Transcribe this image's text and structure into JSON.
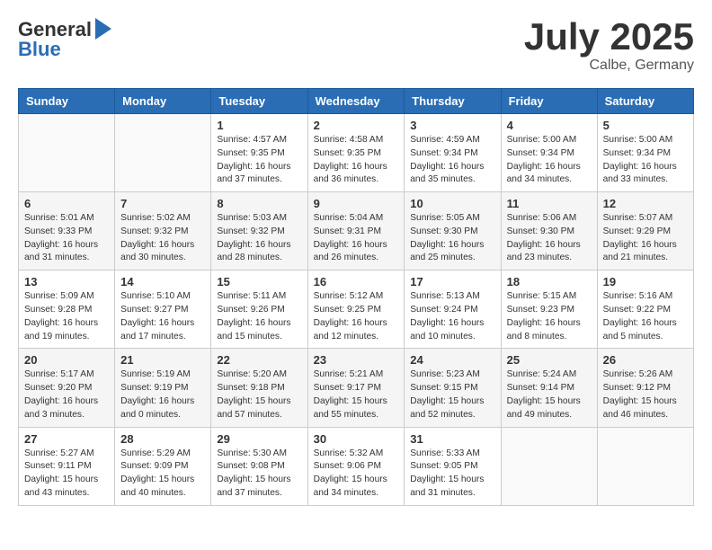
{
  "header": {
    "logo_general": "General",
    "logo_blue": "Blue",
    "title": "July 2025",
    "location": "Calbe, Germany"
  },
  "days_of_week": [
    "Sunday",
    "Monday",
    "Tuesday",
    "Wednesday",
    "Thursday",
    "Friday",
    "Saturday"
  ],
  "weeks": [
    [
      {
        "day": "",
        "info": ""
      },
      {
        "day": "",
        "info": ""
      },
      {
        "day": "1",
        "info": "Sunrise: 4:57 AM\nSunset: 9:35 PM\nDaylight: 16 hours\nand 37 minutes."
      },
      {
        "day": "2",
        "info": "Sunrise: 4:58 AM\nSunset: 9:35 PM\nDaylight: 16 hours\nand 36 minutes."
      },
      {
        "day": "3",
        "info": "Sunrise: 4:59 AM\nSunset: 9:34 PM\nDaylight: 16 hours\nand 35 minutes."
      },
      {
        "day": "4",
        "info": "Sunrise: 5:00 AM\nSunset: 9:34 PM\nDaylight: 16 hours\nand 34 minutes."
      },
      {
        "day": "5",
        "info": "Sunrise: 5:00 AM\nSunset: 9:34 PM\nDaylight: 16 hours\nand 33 minutes."
      }
    ],
    [
      {
        "day": "6",
        "info": "Sunrise: 5:01 AM\nSunset: 9:33 PM\nDaylight: 16 hours\nand 31 minutes."
      },
      {
        "day": "7",
        "info": "Sunrise: 5:02 AM\nSunset: 9:32 PM\nDaylight: 16 hours\nand 30 minutes."
      },
      {
        "day": "8",
        "info": "Sunrise: 5:03 AM\nSunset: 9:32 PM\nDaylight: 16 hours\nand 28 minutes."
      },
      {
        "day": "9",
        "info": "Sunrise: 5:04 AM\nSunset: 9:31 PM\nDaylight: 16 hours\nand 26 minutes."
      },
      {
        "day": "10",
        "info": "Sunrise: 5:05 AM\nSunset: 9:30 PM\nDaylight: 16 hours\nand 25 minutes."
      },
      {
        "day": "11",
        "info": "Sunrise: 5:06 AM\nSunset: 9:30 PM\nDaylight: 16 hours\nand 23 minutes."
      },
      {
        "day": "12",
        "info": "Sunrise: 5:07 AM\nSunset: 9:29 PM\nDaylight: 16 hours\nand 21 minutes."
      }
    ],
    [
      {
        "day": "13",
        "info": "Sunrise: 5:09 AM\nSunset: 9:28 PM\nDaylight: 16 hours\nand 19 minutes."
      },
      {
        "day": "14",
        "info": "Sunrise: 5:10 AM\nSunset: 9:27 PM\nDaylight: 16 hours\nand 17 minutes."
      },
      {
        "day": "15",
        "info": "Sunrise: 5:11 AM\nSunset: 9:26 PM\nDaylight: 16 hours\nand 15 minutes."
      },
      {
        "day": "16",
        "info": "Sunrise: 5:12 AM\nSunset: 9:25 PM\nDaylight: 16 hours\nand 12 minutes."
      },
      {
        "day": "17",
        "info": "Sunrise: 5:13 AM\nSunset: 9:24 PM\nDaylight: 16 hours\nand 10 minutes."
      },
      {
        "day": "18",
        "info": "Sunrise: 5:15 AM\nSunset: 9:23 PM\nDaylight: 16 hours\nand 8 minutes."
      },
      {
        "day": "19",
        "info": "Sunrise: 5:16 AM\nSunset: 9:22 PM\nDaylight: 16 hours\nand 5 minutes."
      }
    ],
    [
      {
        "day": "20",
        "info": "Sunrise: 5:17 AM\nSunset: 9:20 PM\nDaylight: 16 hours\nand 3 minutes."
      },
      {
        "day": "21",
        "info": "Sunrise: 5:19 AM\nSunset: 9:19 PM\nDaylight: 16 hours\nand 0 minutes."
      },
      {
        "day": "22",
        "info": "Sunrise: 5:20 AM\nSunset: 9:18 PM\nDaylight: 15 hours\nand 57 minutes."
      },
      {
        "day": "23",
        "info": "Sunrise: 5:21 AM\nSunset: 9:17 PM\nDaylight: 15 hours\nand 55 minutes."
      },
      {
        "day": "24",
        "info": "Sunrise: 5:23 AM\nSunset: 9:15 PM\nDaylight: 15 hours\nand 52 minutes."
      },
      {
        "day": "25",
        "info": "Sunrise: 5:24 AM\nSunset: 9:14 PM\nDaylight: 15 hours\nand 49 minutes."
      },
      {
        "day": "26",
        "info": "Sunrise: 5:26 AM\nSunset: 9:12 PM\nDaylight: 15 hours\nand 46 minutes."
      }
    ],
    [
      {
        "day": "27",
        "info": "Sunrise: 5:27 AM\nSunset: 9:11 PM\nDaylight: 15 hours\nand 43 minutes."
      },
      {
        "day": "28",
        "info": "Sunrise: 5:29 AM\nSunset: 9:09 PM\nDaylight: 15 hours\nand 40 minutes."
      },
      {
        "day": "29",
        "info": "Sunrise: 5:30 AM\nSunset: 9:08 PM\nDaylight: 15 hours\nand 37 minutes."
      },
      {
        "day": "30",
        "info": "Sunrise: 5:32 AM\nSunset: 9:06 PM\nDaylight: 15 hours\nand 34 minutes."
      },
      {
        "day": "31",
        "info": "Sunrise: 5:33 AM\nSunset: 9:05 PM\nDaylight: 15 hours\nand 31 minutes."
      },
      {
        "day": "",
        "info": ""
      },
      {
        "day": "",
        "info": ""
      }
    ]
  ]
}
